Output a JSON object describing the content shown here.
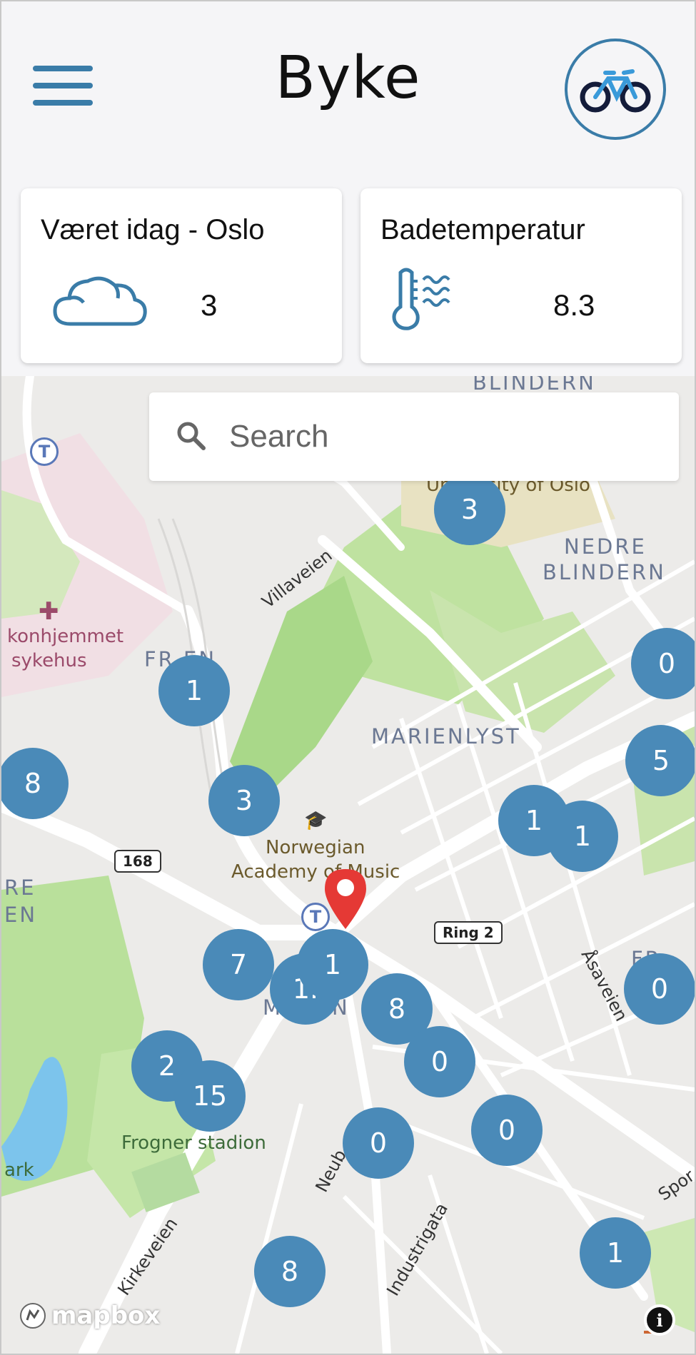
{
  "header": {
    "title": "Byke"
  },
  "weather_card": {
    "title": "Været idag - Oslo",
    "value": "3"
  },
  "bath_card": {
    "title": "Badetemperatur",
    "value": "8.3"
  },
  "search": {
    "placeholder": "Search"
  },
  "map": {
    "clusters": [
      "3",
      "0",
      "1",
      "5",
      "8",
      "3",
      "1",
      "1",
      "7",
      "1",
      "1.",
      "8",
      "0",
      "2",
      "15",
      "0",
      "0",
      "0",
      "1",
      "8"
    ],
    "areas": {
      "blindern": "BLINDERN",
      "nedre1": "NEDRE",
      "nedre2": "BLINDERN",
      "fren": "FR   EN",
      "marienlyst": "MARIENLYST",
      "majorstuen": "M    RS    N",
      "re": "RE",
      "en": "EN",
      "nbr": "FR"
    },
    "pois": {
      "university": "University of Oslo",
      "music1": "Norwegian",
      "music2": "Academy of Music",
      "hospital1": "konhjemmet",
      "hospital2": "sykehus",
      "stadium": "Frogner stadion",
      "park": "ark"
    },
    "streets": {
      "villaveien": "Villaveien",
      "asaveien": "Åsaveien",
      "kirkeveien": "Kirkeveien",
      "industrigata": "Industrigata",
      "neub": "Neub",
      "spor": "Spor"
    },
    "shields": {
      "r168": "168",
      "ring2": "Ring 2"
    },
    "attribution": "mapbox"
  },
  "colors": {
    "accent": "#3a7ca8",
    "cluster": "#4a8ab8",
    "pin": "#e53935"
  }
}
